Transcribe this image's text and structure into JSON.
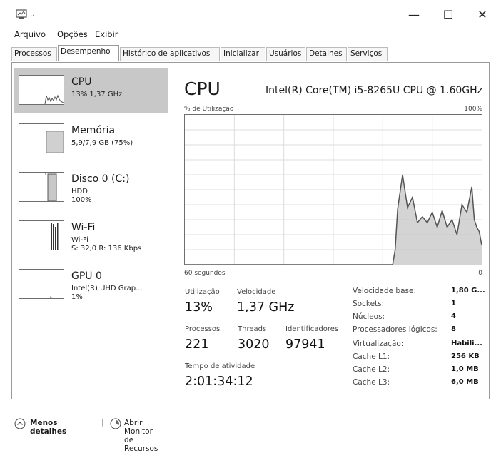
{
  "window": {
    "title": "..",
    "minimize_glyph": "—",
    "maximize_glyph": "☐",
    "close_glyph": "✕"
  },
  "menu": [
    "Arquivo",
    "Opções",
    "Exibir"
  ],
  "tabs": [
    {
      "label": "Processos",
      "active": false
    },
    {
      "label": "Desempenho",
      "active": true
    },
    {
      "label": "Histórico de aplicativos",
      "active": false
    },
    {
      "label": "Inicializar",
      "active": false
    },
    {
      "label": "Usuários",
      "active": false
    },
    {
      "label": "Detalhes",
      "active": false
    },
    {
      "label": "Serviços",
      "active": false
    }
  ],
  "sidebar": {
    "items": [
      {
        "title": "CPU",
        "lines": [
          "13% 1,37 GHz"
        ],
        "selected": true,
        "usage_percent": 13
      },
      {
        "title": "Memória",
        "lines": [
          "5,9/7,9 GB (75%)"
        ],
        "selected": false,
        "usage_percent": 75
      },
      {
        "title": "Disco 0 (C:)",
        "lines": [
          "HDD",
          "100%"
        ],
        "selected": false,
        "usage_percent": 100
      },
      {
        "title": "Wi-Fi",
        "lines": [
          "Wi-Fi",
          "S: 32,0  R: 136 Kbps"
        ],
        "selected": false
      },
      {
        "title": "GPU 0",
        "lines": [
          "Intel(R) UHD Grap...",
          "1%"
        ],
        "selected": false,
        "usage_percent": 1
      }
    ]
  },
  "main": {
    "title": "CPU",
    "processor": "Intel(R) Core(TM) i5-8265U CPU @ 1.60GHz",
    "graph_top_left": "% de Utilização",
    "graph_top_right": "100%",
    "graph_bottom_left": "60 segundos",
    "graph_bottom_right": "0"
  },
  "chart_data": {
    "type": "area",
    "xlabel": "60 segundos",
    "ylabel": "% de Utilização",
    "ylim": [
      0,
      100
    ],
    "xlim": [
      60,
      0
    ],
    "x": [
      60,
      56,
      52,
      48,
      44,
      40,
      36,
      32,
      28,
      24,
      22,
      20,
      18,
      17.5,
      17,
      16,
      15,
      14,
      13,
      12,
      11,
      10,
      9,
      8,
      7,
      6,
      5,
      4,
      3,
      2,
      1.5,
      1,
      0.5,
      0
    ],
    "values": [
      0,
      0,
      0,
      0,
      0,
      0,
      0,
      0,
      0,
      0,
      0,
      0,
      0,
      10,
      37,
      60,
      38,
      45,
      28,
      32,
      28,
      35,
      25,
      36,
      25,
      30,
      20,
      40,
      35,
      52,
      30,
      25,
      22,
      13
    ],
    "grid": true,
    "color": "#c9c9c9"
  },
  "stats": {
    "utilizacao": {
      "label": "Utilização",
      "value": "13%"
    },
    "velocidade": {
      "label": "Velocidade",
      "value": "1,37 GHz"
    },
    "processos": {
      "label": "Processos",
      "value": "221"
    },
    "threads": {
      "label": "Threads",
      "value": "3020"
    },
    "identificadores": {
      "label": "Identificadores",
      "value": "97941"
    },
    "tempo": {
      "label": "Tempo de atividade",
      "value": "2:01:34:12"
    }
  },
  "specs": [
    {
      "label": "Velocidade base:",
      "value": "1,80 G..."
    },
    {
      "label": "Sockets:",
      "value": "1"
    },
    {
      "label": "Núcleos:",
      "value": "4"
    },
    {
      "label": "Processadores lógicos:",
      "value": "8"
    },
    {
      "label": "Virtualização:",
      "value": "Habili..."
    },
    {
      "label": "Cache L1:",
      "value": "256 KB"
    },
    {
      "label": "Cache L2:",
      "value": "1,0 MB"
    },
    {
      "label": "Cache L3:",
      "value": "6,0 MB"
    }
  ],
  "footer": {
    "less_details": "Menos detalhes",
    "separator": "|",
    "resource_monitor": "Abrir Monitor de Recursos"
  }
}
